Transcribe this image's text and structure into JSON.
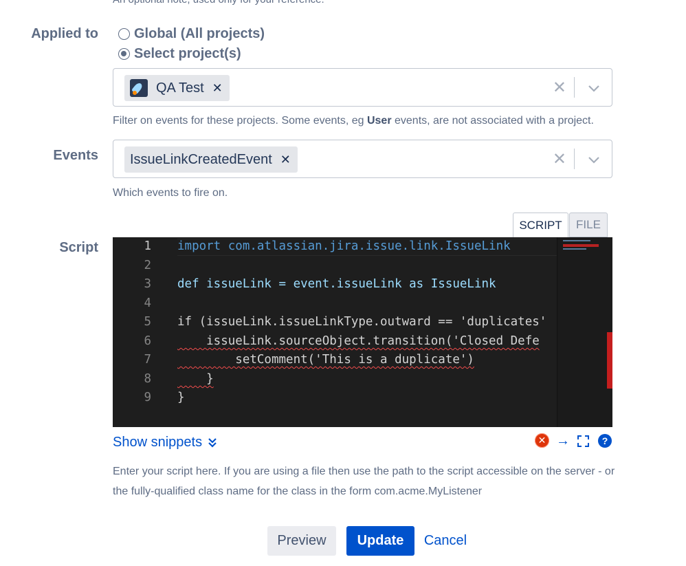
{
  "top_help_clipped": "An optional note, used only for your reference.",
  "applied_to": {
    "label": "Applied to",
    "options": [
      {
        "label": "Global (All projects)",
        "checked": false
      },
      {
        "label": "Select project(s)",
        "checked": true
      }
    ],
    "selected_projects": [
      {
        "name": "QA Test",
        "icon": "rocket-project-avatar"
      }
    ],
    "help_prefix": "Filter on events for these projects. Some events, eg ",
    "help_bold": "User",
    "help_suffix": " events, are not associated with a project."
  },
  "events": {
    "label": "Events",
    "selected": [
      {
        "name": "IssueLinkCreatedEvent"
      }
    ],
    "help": "Which events to fire on."
  },
  "script": {
    "label": "Script",
    "tabs": {
      "script": "SCRIPT",
      "file": "FILE",
      "active": "SCRIPT"
    },
    "line_numbers": [
      "1",
      "2",
      "3",
      "4",
      "5",
      "6",
      "7",
      "8",
      "9"
    ],
    "code_lines": [
      "import com.atlassian.jira.issue.link.IssueLink",
      "",
      "def issueLink = event.issueLink as IssueLink",
      "",
      "if (issueLink.issueLinkType.outward == 'duplicates'",
      "    issueLink.sourceObject.transition('Closed Defe",
      "        setComment('This is a duplicate')",
      "    }",
      "}"
    ],
    "show_snippets": "Show snippets",
    "help": "Enter your script here. If you are using a file then use the path to the script accessible on the server - or the fully-qualified class name for the class in the form com.acme.MyListener",
    "icons": [
      "error-icon",
      "arrow-right-icon",
      "fullscreen-icon",
      "help-icon"
    ]
  },
  "colors": {
    "primary": "#0052cc",
    "editor_bg": "#1e1e1e",
    "error": "#de350b"
  },
  "actions": {
    "preview": "Preview",
    "update": "Update",
    "cancel": "Cancel"
  }
}
